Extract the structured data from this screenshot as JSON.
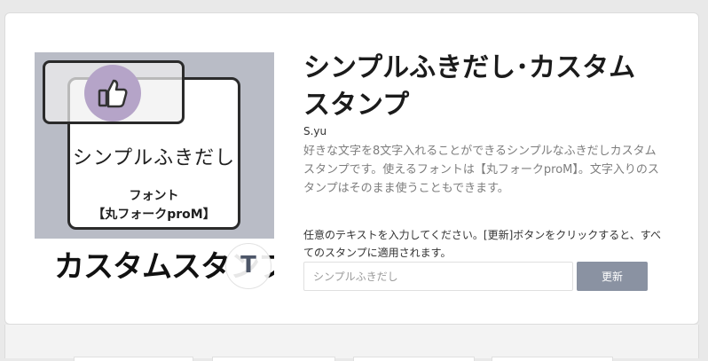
{
  "product": {
    "title": "シンプルふきだし･カスタムスタンプ",
    "author": "S.yu",
    "description": "好きな文字を8文字入れることができるシンプルなふきだしカスタムスタンプです。使えるフォントは【丸フォークproM】。文字入りのスタンプはそのまま使うこともできます。"
  },
  "image": {
    "bubble_text": "シンプルふきだし",
    "font_label": "フォント",
    "font_name": "【丸フォークproM】",
    "banner_text": "カスタムスタンプ",
    "t_badge": "T",
    "thumb_icon": "thumbs-up-icon",
    "colors": {
      "background": "#b9bcc6",
      "circle": "#b5a4c8"
    }
  },
  "custom_text": {
    "instructions": "任意のテキストを入力してください。[更新]ボタンをクリックすると、すべてのスタンプに適用されます。",
    "input_placeholder": "シンプルふきだし",
    "update_label": "更新"
  }
}
